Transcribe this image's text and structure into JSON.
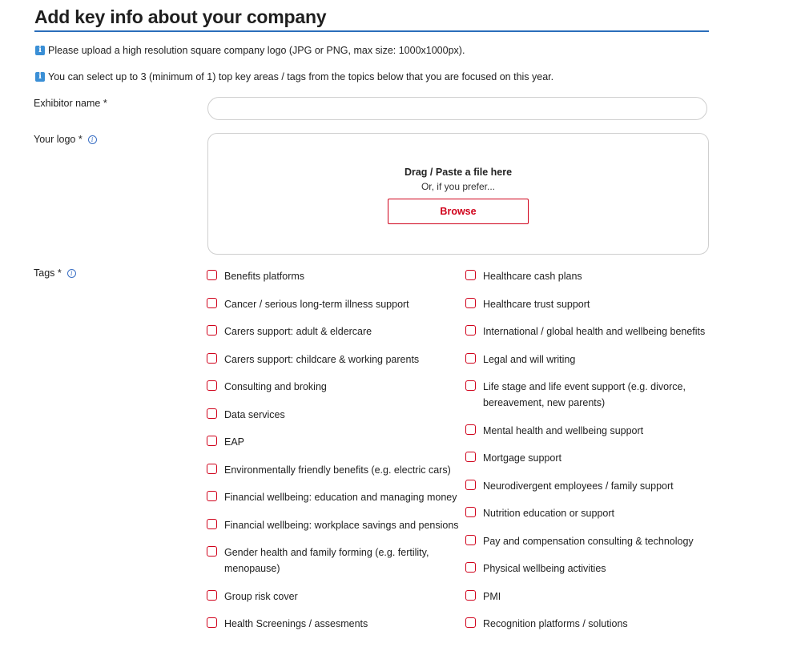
{
  "page": {
    "title": "Add key info about your company",
    "info_icon": "i",
    "info_logo": "Please upload a high resolution square company logo (JPG or PNG, max size: 1000x1000px).",
    "info_tags": "You can select up to 3 (minimum of 1) top key areas / tags from the topics below that you are focused on this year."
  },
  "form": {
    "exhibitor_label": "Exhibitor name *",
    "exhibitor_value": "",
    "logo_label": "Your logo *",
    "help_icon": "i",
    "dropzone_title": "Drag / Paste a file here",
    "dropzone_sub": "Or, if you prefer...",
    "browse_label": "Browse",
    "tags_label": "Tags *"
  },
  "tags_left": [
    "Benefits platforms",
    "Cancer / serious long-term illness support",
    "Carers support: adult & eldercare",
    "Carers support: childcare & working parents",
    "Consulting and broking",
    "Data services",
    "EAP",
    "Environmentally friendly benefits (e.g. electric cars)",
    "Financial wellbeing: education and managing money",
    "Financial wellbeing: workplace savings and pensions",
    "Gender health and family forming (e.g. fertility, menopause)",
    "Group risk cover",
    "Health Screenings / assesments"
  ],
  "tags_right": [
    "Healthcare cash plans",
    "Healthcare trust support",
    "International / global health and wellbeing benefits",
    "Legal and will writing",
    "Life stage and life event support (e.g. divorce, bereavement, new parents)",
    "Mental health and wellbeing support",
    "Mortgage support",
    "Neurodivergent employees / family support",
    "Nutrition education or support",
    "Pay and compensation consulting & technology",
    "Physical wellbeing activities",
    "PMI",
    "Recognition platforms / solutions"
  ],
  "colors": {
    "accent_red": "#d0021b",
    "title_underline": "#2a6ebb",
    "info_blue": "#3a8fd6"
  }
}
